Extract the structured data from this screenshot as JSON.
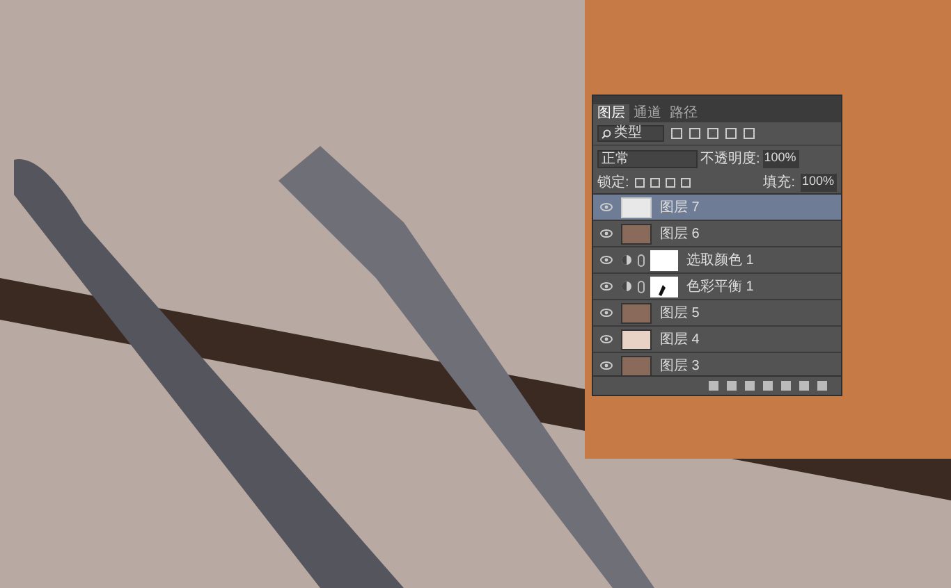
{
  "panel": {
    "tabs": [
      {
        "label": "图层",
        "selected": true
      },
      {
        "label": "通道",
        "selected": false
      },
      {
        "label": "路径",
        "selected": false
      }
    ],
    "filter": {
      "value": "类型"
    },
    "blend_mode": {
      "value": "正常"
    },
    "opacity": {
      "label": "不透明度:",
      "value": "100%"
    },
    "lock": {
      "label": "锁定:"
    },
    "fill": {
      "label": "填充:",
      "value": "100%"
    },
    "layers": [
      {
        "name": "图层 7",
        "kind": "blank",
        "selected": true
      },
      {
        "name": "图层 6",
        "kind": "photo",
        "selected": false
      },
      {
        "name": "选取颜色 1",
        "kind": "adjustment",
        "selected": false
      },
      {
        "name": "色彩平衡 1",
        "kind": "adjustment-mask",
        "selected": false
      },
      {
        "name": "图层 5",
        "kind": "photo",
        "selected": false
      },
      {
        "name": "图层 4",
        "kind": "light",
        "selected": false
      },
      {
        "name": "图层 3",
        "kind": "photo",
        "selected": false
      }
    ]
  }
}
